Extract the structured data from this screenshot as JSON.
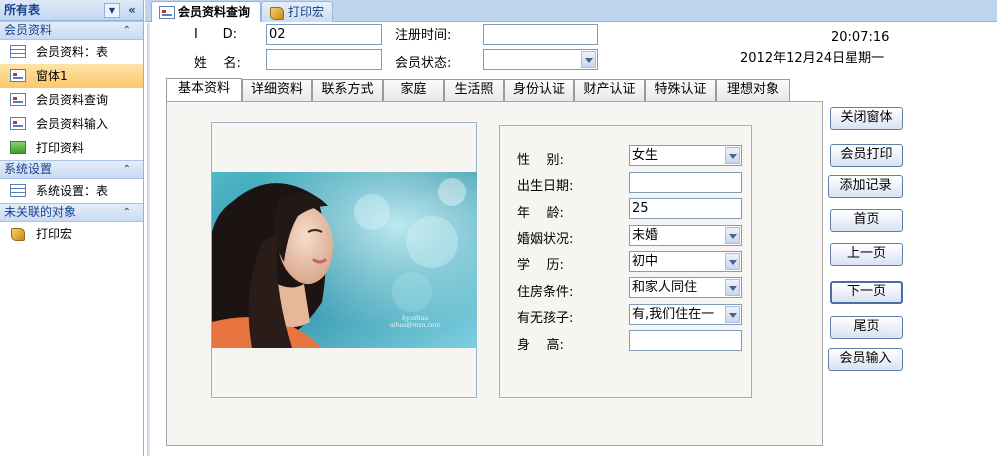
{
  "nav": {
    "header": "所有表",
    "groups": [
      {
        "title": "会员资料",
        "items": [
          {
            "label": "会员资料：表",
            "icon": "table-icon"
          },
          {
            "label": "窗体1",
            "icon": "form-icon"
          },
          {
            "label": "会员资料查询",
            "icon": "query-form-icon"
          },
          {
            "label": "会员资料输入",
            "icon": "form-icon"
          },
          {
            "label": "打印资料",
            "icon": "report-icon"
          }
        ]
      },
      {
        "title": "系统设置",
        "items": [
          {
            "label": "系统设置：表",
            "icon": "table-icon"
          }
        ]
      },
      {
        "title": "未关联的对象",
        "items": [
          {
            "label": "打印宏",
            "icon": "macro-icon"
          }
        ]
      }
    ]
  },
  "doc_tabs": [
    {
      "label": "会员资料查询",
      "active": true
    },
    {
      "label": "打印宏",
      "active": false
    }
  ],
  "form": {
    "id_label": "I      D:",
    "id_value": "02",
    "name_label": "姓    名:",
    "name_value": "",
    "reg_time_label": "注册时间:",
    "reg_time_value": "",
    "status_label": "会员状态:",
    "status_value": "",
    "time": "20:07:16",
    "date": "2012年12月24日星期一"
  },
  "form_tabs": [
    "基本资料",
    "详细资料",
    "联系方式",
    "家庭",
    "生活照",
    "身份认证",
    "财产认证",
    "特殊认证",
    "理想对象"
  ],
  "photo_watermark": "by:aihua\naihua@msn.com",
  "basic_info": [
    {
      "label": "性    别:",
      "value": "女生",
      "combo": true
    },
    {
      "label": "出生日期:",
      "value": "",
      "combo": false
    },
    {
      "label": "年    龄:",
      "value": "25",
      "combo": false
    },
    {
      "label": "婚姻状况:",
      "value": "未婚",
      "combo": true
    },
    {
      "label": "学    历:",
      "value": "初中",
      "combo": true
    },
    {
      "label": "住房条件:",
      "value": "和家人同住",
      "combo": true
    },
    {
      "label": "有无孩子:",
      "value": "有,我们住在一",
      "combo": true
    },
    {
      "label": "身    高:",
      "value": "",
      "combo": false
    }
  ],
  "buttons": [
    "关闭窗体",
    "会员打印",
    "添加记录",
    "首页",
    "上一页",
    "下一页",
    "尾页",
    "会员输入"
  ]
}
